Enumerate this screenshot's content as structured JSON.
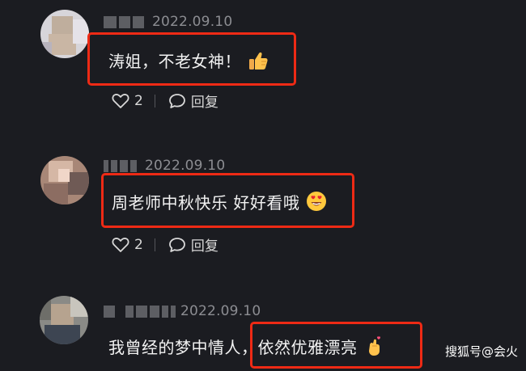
{
  "colors": {
    "background": "#1b1c21",
    "highlight_box": "#ee2a15",
    "date_text": "#8c8d92",
    "comment_text": "#f2f2f2"
  },
  "comments": [
    {
      "date": "2022.09.10",
      "text": "涛姐，不老女神！",
      "emoji": "thumbs-up",
      "likes": "2",
      "reply_label": "回复"
    },
    {
      "date": "2022.09.10",
      "text": "周老师中秋快乐 好好看哦",
      "emoji": "heart-eyes-face",
      "likes": "2",
      "reply_label": "回复"
    },
    {
      "date": "2022.09.10",
      "text_prefix": "我曾经的梦中情人，",
      "text_highlight": "依然优雅漂亮",
      "emoji": "finger-heart"
    }
  ],
  "watermark": "搜狐号@会火"
}
